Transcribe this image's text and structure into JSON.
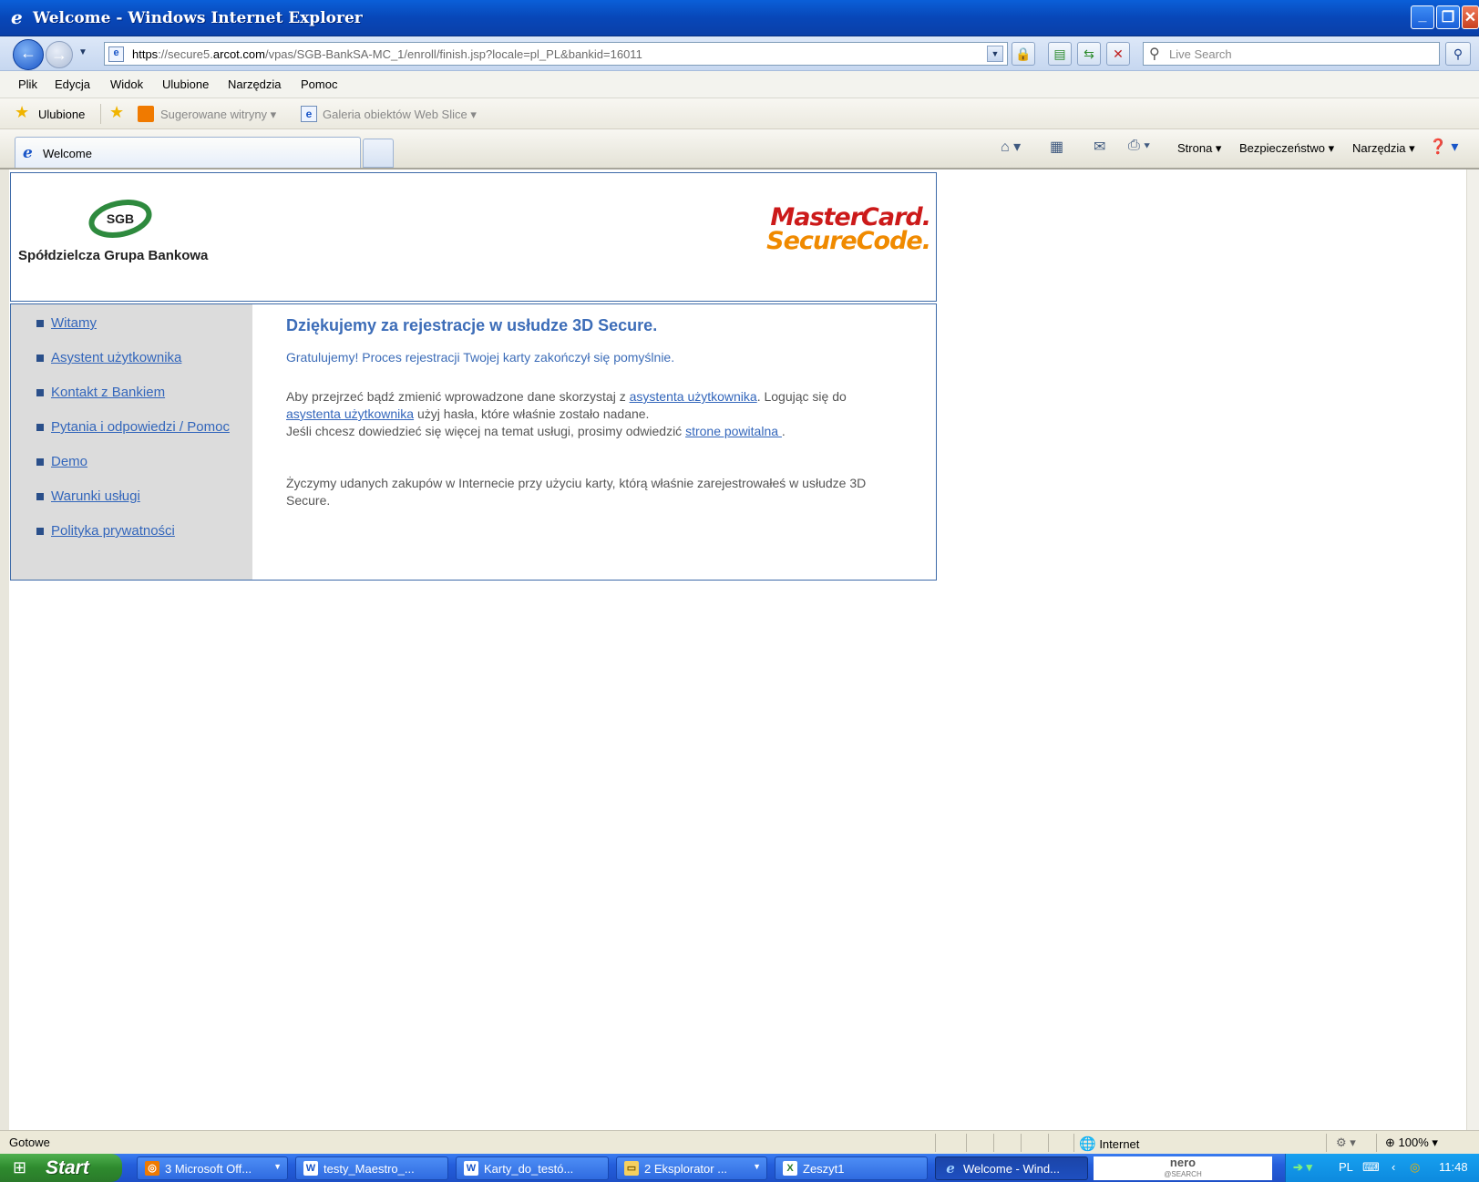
{
  "window": {
    "title": "Welcome - Windows Internet Explorer",
    "controls": [
      "_",
      "❐",
      "✕"
    ]
  },
  "address": {
    "url_prefix": "https",
    "url_sep": "://secure5.",
    "url_domain": "arcot.com",
    "url_path": "/vpas/SGB-BankSA-MC_1/enroll/finish.jsp?locale=pl_PL&bankid=16011",
    "search_placeholder": "Live Search"
  },
  "menu": [
    "Plik",
    "Edycja",
    "Widok",
    "Ulubione",
    "Narzędzia",
    "Pomoc"
  ],
  "favorites": {
    "ulubione": "Ulubione",
    "suggested": "Sugerowane witryny",
    "webslice": "Galeria obiektów Web Slice"
  },
  "tab": {
    "title": "Welcome"
  },
  "commands": {
    "page": "Strona",
    "security": "Bezpieczeństwo",
    "tools": "Narzędzia"
  },
  "page": {
    "bank_logo_text": "SGB",
    "bank_name": "Spółdzielcza Grupa Bankowa",
    "mc_line1": "MasterCard.",
    "mc_line2": "SecureCode.",
    "nav": [
      "Witamy",
      "Asystent użytkownika",
      "Kontakt z Bankiem",
      "Pytania i odpowiedzi / Pomoc",
      "Demo",
      "Warunki usługi",
      "Polityka prywatności"
    ],
    "heading": "Dziękujemy za rejestracje w usłudze 3D Secure.",
    "congrats": "Gratulujemy! Proces rejestracji Twojej karty zakończył się pomyślnie.",
    "p1_a": "Aby przejrzeć bądź zmienić wprowadzone dane skorzystaj z ",
    "p1_link1": "asystenta użytkownika",
    "p1_b": ". Logując się do ",
    "p1_link2": "asystenta użytkownika",
    "p1_c": " użyj hasła, które właśnie zostało nadane.",
    "p2_a": "Jeśli chcesz dowiedzieć się więcej na temat usługi, prosimy odwiedzić ",
    "p2_link": "strone powitalna ",
    "p2_b": ".",
    "wish": "Życzymy udanych zakupów w Internecie przy użyciu karty, którą właśnie zarejestrowałeś w usłudze 3D Secure."
  },
  "status": {
    "text": "Gotowe",
    "zone": "Internet",
    "zoom": "100%"
  },
  "taskbar": {
    "start": "Start",
    "items": [
      "3 Microsoft Off...",
      "testy_Maestro_...",
      "Karty_do_testó...",
      "2 Eksplorator ...",
      "Zeszyt1",
      "Welcome - Wind..."
    ],
    "nero_line1": "nero",
    "nero_line2": "@SEARCH",
    "lang": "PL",
    "clock": "11:48"
  },
  "colors": {
    "link": "#3366bb",
    "heading": "#3d6db8",
    "mc_red": "#cc1a1a",
    "mc_orange": "#f08a00",
    "sgb_green": "#2e8a3e"
  }
}
